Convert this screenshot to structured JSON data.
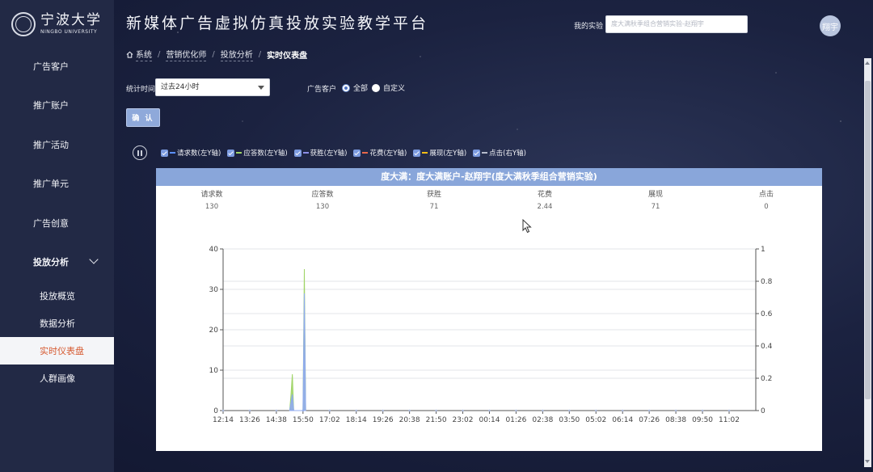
{
  "logo": {
    "cn": "宁波大学",
    "en": "NINGBO UNIVERSITY"
  },
  "header": {
    "title": "新媒体广告虚拟仿真投放实验教学平台",
    "experiment_label": "我的实验",
    "experiment_value": "度大满秋季组合营销实验-赵翔宇",
    "avatar_text": "翔宇"
  },
  "breadcrumb": [
    {
      "label": "系统"
    },
    {
      "label": "营销优化师"
    },
    {
      "label": "投放分析"
    },
    {
      "label": "实时仪表盘"
    }
  ],
  "sidebar": {
    "items": [
      {
        "label": "广告客户",
        "name": "sidebar-item-ad-clients"
      },
      {
        "label": "推广账户",
        "name": "sidebar-item-promo-accounts"
      },
      {
        "label": "推广活动",
        "name": "sidebar-item-promo-campaigns"
      },
      {
        "label": "推广单元",
        "name": "sidebar-item-promo-units"
      },
      {
        "label": "广告创意",
        "name": "sidebar-item-ad-creatives"
      },
      {
        "label": "投放分析",
        "name": "sidebar-item-delivery-analysis"
      }
    ],
    "sub_items": [
      {
        "label": "投放概览",
        "name": "sidebar-subitem-overview"
      },
      {
        "label": "数据分析",
        "name": "sidebar-subitem-data-analysis"
      },
      {
        "label": "实时仪表盘",
        "name": "sidebar-subitem-realtime-dashboard",
        "active": true
      },
      {
        "label": "人群画像",
        "name": "sidebar-subitem-audience-profile"
      }
    ]
  },
  "filters": {
    "time_label": "统计时间",
    "time_value": "过去24小时",
    "client_label": "广告客户",
    "radio_all": "全部",
    "radio_custom": "自定义",
    "confirm": "确 认"
  },
  "legend": [
    {
      "label": "请求数(左Y轴)",
      "color": "#5b8ff9"
    },
    {
      "label": "应答数(左Y轴)",
      "color": "#9fd466"
    },
    {
      "label": "获胜(左Y轴)",
      "color": "#8c8fe8"
    },
    {
      "label": "花费(左Y轴)",
      "color": "#e8684a"
    },
    {
      "label": "展现(左Y轴)",
      "color": "#f6bd16"
    },
    {
      "label": "点击(右Y轴)",
      "color": "#b7bccc"
    }
  ],
  "panel": {
    "title": "度大满：度大满账户-赵翔宇(度大满秋季组合营销实验)",
    "stats": [
      {
        "label": "请求数",
        "value": "130"
      },
      {
        "label": "应答数",
        "value": "130"
      },
      {
        "label": "获胜",
        "value": "71"
      },
      {
        "label": "花费",
        "value": "2.44"
      },
      {
        "label": "展现",
        "value": "71"
      },
      {
        "label": "点击",
        "value": "0"
      }
    ]
  },
  "chart_data": {
    "type": "area",
    "x_ticks": [
      "12:14",
      "13:26",
      "14:38",
      "15:50",
      "17:02",
      "18:14",
      "19:26",
      "20:38",
      "21:50",
      "23:02",
      "00:14",
      "01:26",
      "02:38",
      "03:50",
      "05:02",
      "06:14",
      "07:26",
      "08:38",
      "09:50",
      "11:02"
    ],
    "left_yticks": [
      0,
      10,
      20,
      30,
      40
    ],
    "right_yticks": [
      0,
      0.2,
      0.4,
      0.6,
      0.8,
      1
    ],
    "left_ylim": [
      0,
      40
    ],
    "right_ylim": [
      0,
      1
    ],
    "series": [
      {
        "name": "应答数(左Y轴)",
        "color": "#9fd466",
        "points": [
          [
            2.5,
            0
          ],
          [
            2.55,
            4
          ],
          [
            2.6,
            9
          ],
          [
            2.65,
            0
          ],
          [
            3.0,
            0
          ],
          [
            3.05,
            35
          ],
          [
            3.1,
            0
          ]
        ]
      },
      {
        "name": "请求数(左Y轴)",
        "color": "#8fa9f2",
        "points": [
          [
            2.5,
            0
          ],
          [
            2.55,
            2
          ],
          [
            2.6,
            4
          ],
          [
            2.65,
            0
          ],
          [
            3.0,
            0
          ],
          [
            3.05,
            29
          ],
          [
            3.1,
            0
          ]
        ]
      },
      {
        "name": "点击(右Y轴)",
        "color": "#b7bccc",
        "points": []
      }
    ],
    "grid": true
  }
}
